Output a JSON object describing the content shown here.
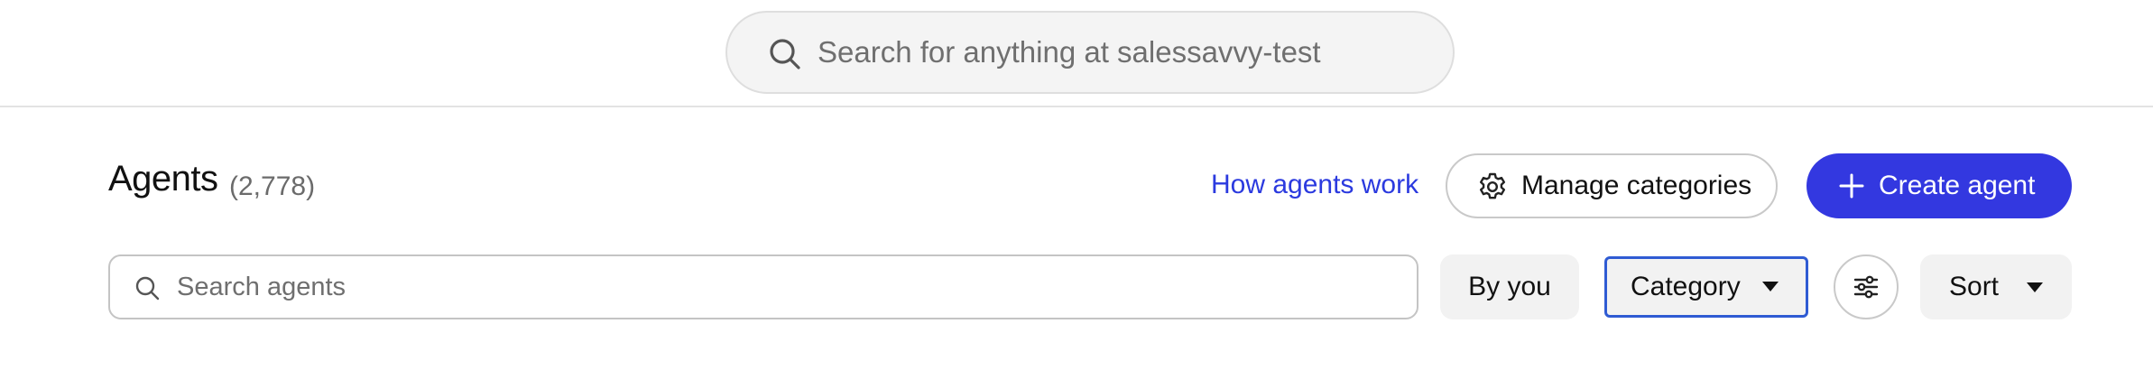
{
  "top_search": {
    "placeholder": "Search for anything at salessavvy-test",
    "icon": "search-icon"
  },
  "header": {
    "title": "Agents",
    "count": "(2,778)",
    "how_link": "How agents work",
    "manage_label": "Manage categories",
    "manage_icon": "gear-icon",
    "create_label": "Create agent",
    "create_icon": "plus-icon"
  },
  "filters": {
    "search_placeholder": "Search agents",
    "by_you_label": "By you",
    "category_label": "Category",
    "filter_icon": "sliders-icon",
    "sort_label": "Sort"
  },
  "colors": {
    "accent": "#3338e0",
    "link": "#2b3adf",
    "focus_border": "#2f5bd3"
  }
}
